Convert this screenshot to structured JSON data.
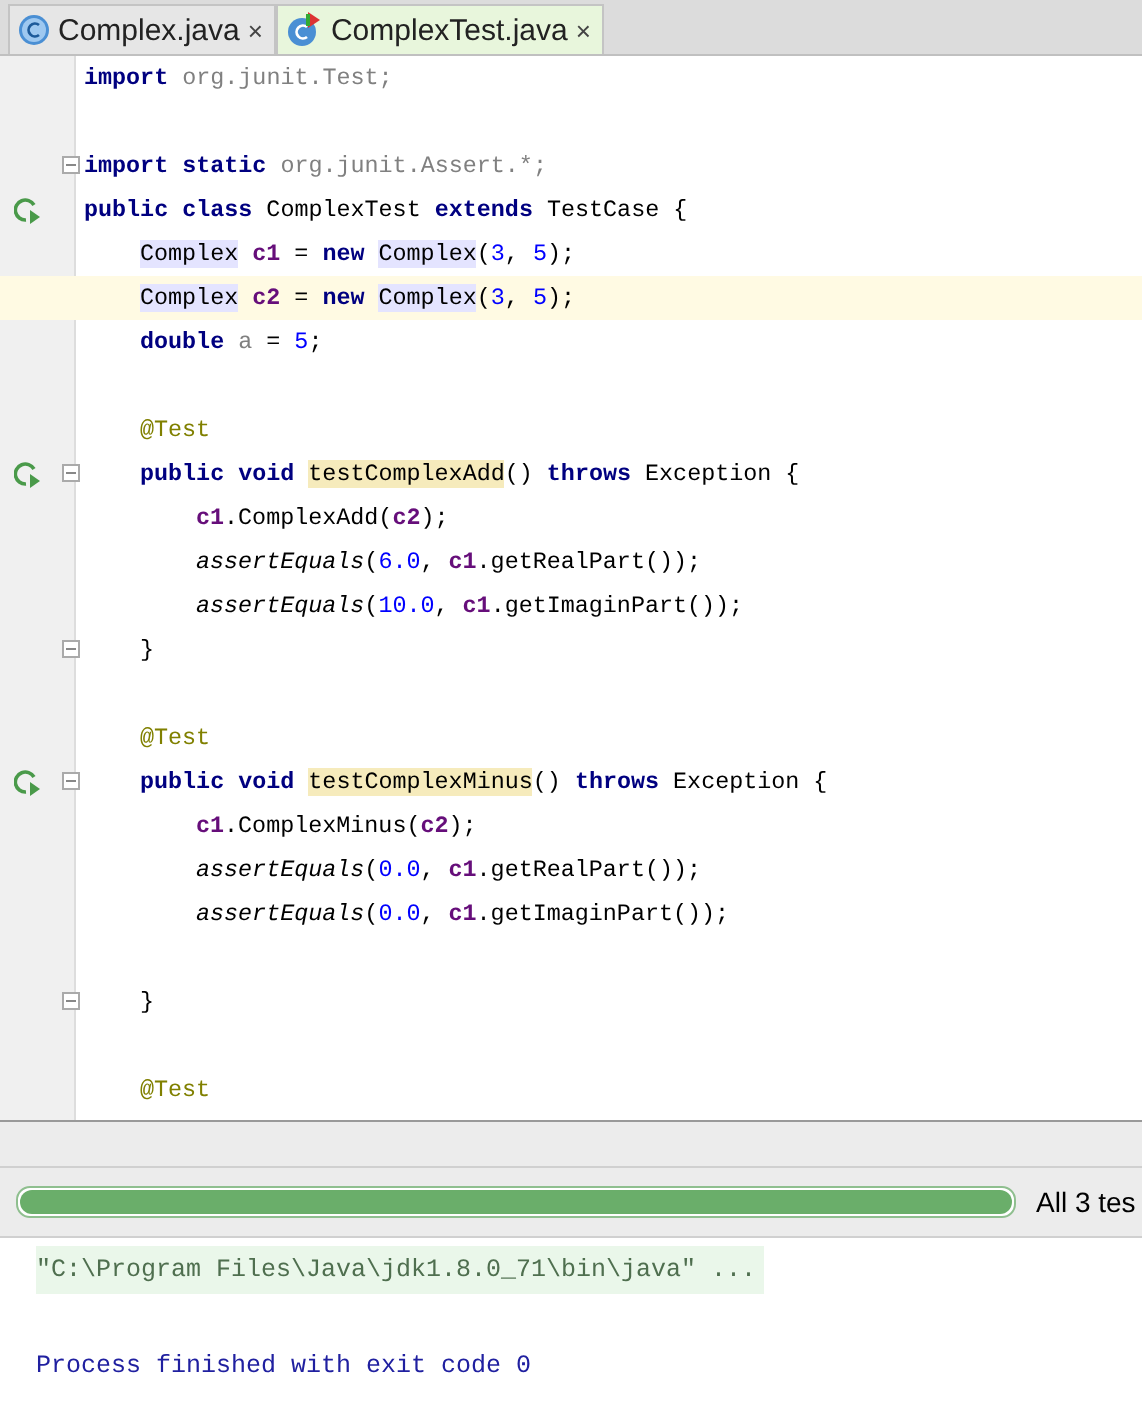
{
  "tabs": [
    {
      "label": "Complex.java",
      "kind": "class",
      "selected": false,
      "close": "×"
    },
    {
      "label": "ComplexTest.java",
      "kind": "test",
      "selected": true,
      "close": "×"
    }
  ],
  "editor": {
    "lines": [
      {
        "kind": "code",
        "tokens": [
          {
            "kind": "kw",
            "t": "import "
          },
          {
            "kind": "grey",
            "t": "org.junit.Test;"
          }
        ]
      },
      {
        "kind": "blank"
      },
      {
        "kind": "code",
        "fold": true,
        "tokens": [
          {
            "kind": "kw",
            "t": "import static "
          },
          {
            "kind": "grey",
            "t": "org.junit.Assert.*;"
          }
        ]
      },
      {
        "kind": "code",
        "run": true,
        "tokens": [
          {
            "kind": "kw",
            "t": "public class"
          },
          {
            "kind": "plain",
            "t": " ComplexTest "
          },
          {
            "kind": "kw",
            "t": "extends"
          },
          {
            "kind": "plain",
            "t": " TestCase {"
          }
        ],
        "children": [
          {
            "kind": "code",
            "tokens": [
              {
                "kind": "ref",
                "t": "Complex"
              },
              {
                "kind": "field",
                "t": " c1"
              },
              {
                "kind": "plain",
                "t": " = "
              },
              {
                "kind": "kw",
                "t": "new "
              },
              {
                "kind": "ref",
                "t": "Complex"
              },
              {
                "kind": "plain",
                "t": "("
              },
              {
                "kind": "num",
                "t": "3"
              },
              {
                "kind": "plain",
                "t": ", "
              },
              {
                "kind": "num",
                "t": "5"
              },
              {
                "kind": "plain",
                "t": ");"
              }
            ]
          },
          {
            "kind": "code",
            "current": true,
            "tokens": [
              {
                "kind": "ref",
                "t": "Complex"
              },
              {
                "kind": "field",
                "t": " c2"
              },
              {
                "kind": "plain",
                "t": " = "
              },
              {
                "kind": "kw",
                "t": "new "
              },
              {
                "kind": "ref",
                "t": "Complex"
              },
              {
                "kind": "plain",
                "t": "("
              },
              {
                "kind": "num",
                "t": "3"
              },
              {
                "kind": "plain",
                "t": ", "
              },
              {
                "kind": "num",
                "t": "5"
              },
              {
                "kind": "plain",
                "t": ");"
              }
            ]
          },
          {
            "kind": "code",
            "tokens": [
              {
                "kind": "kw",
                "t": "double "
              },
              {
                "kind": "grey",
                "t": "a"
              },
              {
                "kind": "plain",
                "t": " = "
              },
              {
                "kind": "num",
                "t": "5"
              },
              {
                "kind": "plain",
                "t": ";"
              }
            ]
          },
          {
            "kind": "blank"
          },
          {
            "kind": "code",
            "tokens": [
              {
                "kind": "ann",
                "t": "@Test"
              }
            ]
          },
          {
            "kind": "code",
            "run": true,
            "fold": true,
            "tokens": [
              {
                "kind": "kw",
                "t": "public void "
              },
              {
                "kind": "decl",
                "t": "testComplexAdd"
              },
              {
                "kind": "plain",
                "t": "() "
              },
              {
                "kind": "kw",
                "t": "throws"
              },
              {
                "kind": "plain",
                "t": " Exception {"
              }
            ],
            "children": [
              {
                "kind": "code",
                "tokens": [
                  {
                    "kind": "field",
                    "t": "c1"
                  },
                  {
                    "kind": "plain",
                    "t": ".ComplexAdd("
                  },
                  {
                    "kind": "field",
                    "t": "c2"
                  },
                  {
                    "kind": "plain",
                    "t": ");"
                  }
                ]
              },
              {
                "kind": "code",
                "tokens": [
                  {
                    "kind": "italic",
                    "t": "assertEquals"
                  },
                  {
                    "kind": "plain",
                    "t": "("
                  },
                  {
                    "kind": "num",
                    "t": "6.0"
                  },
                  {
                    "kind": "plain",
                    "t": ", "
                  },
                  {
                    "kind": "field",
                    "t": "c1"
                  },
                  {
                    "kind": "plain",
                    "t": ".getRealPart());"
                  }
                ]
              },
              {
                "kind": "code",
                "tokens": [
                  {
                    "kind": "italic",
                    "t": "assertEquals"
                  },
                  {
                    "kind": "plain",
                    "t": "("
                  },
                  {
                    "kind": "num",
                    "t": "10.0"
                  },
                  {
                    "kind": "plain",
                    "t": ", "
                  },
                  {
                    "kind": "field",
                    "t": "c1"
                  },
                  {
                    "kind": "plain",
                    "t": ".getImaginPart());"
                  }
                ]
              }
            ]
          },
          {
            "kind": "code",
            "fold": true,
            "tokens": [
              {
                "kind": "plain",
                "t": "}"
              }
            ]
          },
          {
            "kind": "blank"
          },
          {
            "kind": "code",
            "tokens": [
              {
                "kind": "ann",
                "t": "@Test"
              }
            ]
          },
          {
            "kind": "code",
            "run": true,
            "fold": true,
            "tokens": [
              {
                "kind": "kw",
                "t": "public void "
              },
              {
                "kind": "decl",
                "t": "testComplexMinus"
              },
              {
                "kind": "plain",
                "t": "() "
              },
              {
                "kind": "kw",
                "t": "throws"
              },
              {
                "kind": "plain",
                "t": " Exception {"
              }
            ],
            "children": [
              {
                "kind": "code",
                "tokens": [
                  {
                    "kind": "field",
                    "t": "c1"
                  },
                  {
                    "kind": "plain",
                    "t": ".ComplexMinus("
                  },
                  {
                    "kind": "field",
                    "t": "c2"
                  },
                  {
                    "kind": "plain",
                    "t": ");"
                  }
                ]
              },
              {
                "kind": "code",
                "tokens": [
                  {
                    "kind": "italic",
                    "t": "assertEquals"
                  },
                  {
                    "kind": "plain",
                    "t": "("
                  },
                  {
                    "kind": "num",
                    "t": "0.0"
                  },
                  {
                    "kind": "plain",
                    "t": ", "
                  },
                  {
                    "kind": "field",
                    "t": "c1"
                  },
                  {
                    "kind": "plain",
                    "t": ".getRealPart());"
                  }
                ]
              },
              {
                "kind": "code",
                "tokens": [
                  {
                    "kind": "italic",
                    "t": "assertEquals"
                  },
                  {
                    "kind": "plain",
                    "t": "("
                  },
                  {
                    "kind": "num",
                    "t": "0.0"
                  },
                  {
                    "kind": "plain",
                    "t": ", "
                  },
                  {
                    "kind": "field",
                    "t": "c1"
                  },
                  {
                    "kind": "plain",
                    "t": ".getImaginPart());"
                  }
                ]
              },
              {
                "kind": "blank"
              }
            ]
          },
          {
            "kind": "code",
            "fold": true,
            "tokens": [
              {
                "kind": "plain",
                "t": "}"
              }
            ]
          },
          {
            "kind": "blank"
          },
          {
            "kind": "code",
            "tokens": [
              {
                "kind": "ann",
                "t": "@Test"
              }
            ]
          }
        ]
      }
    ]
  },
  "test_runner": {
    "level": 1,
    "status": "All 3 tes"
  },
  "console": {
    "lines": [
      {
        "kind": "command",
        "text": "\"C:\\Program Files\\Java\\jdk1.8.0_71\\bin\\java\" ..."
      },
      {
        "kind": "blank"
      },
      {
        "kind": "info",
        "text": "Process finished with exit code 0"
      }
    ]
  }
}
